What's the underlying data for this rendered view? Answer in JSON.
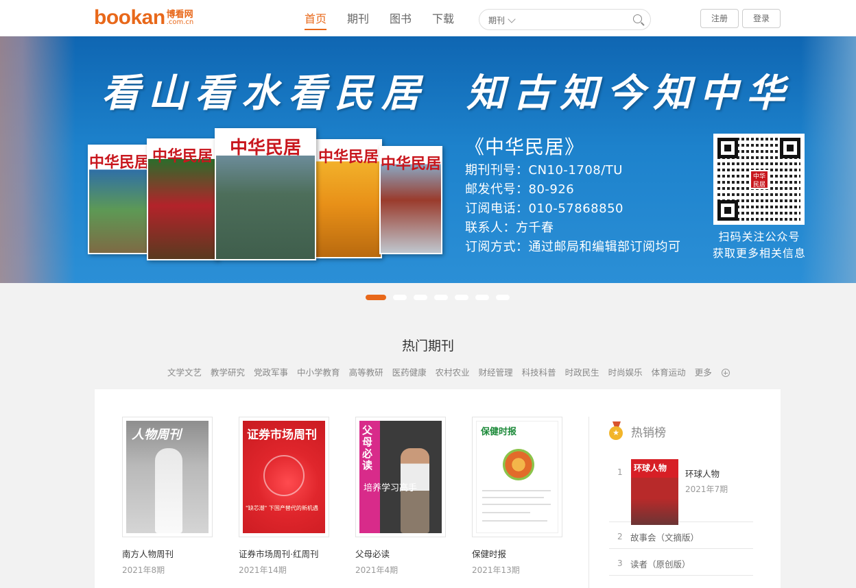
{
  "header": {
    "logo_main": "bookan",
    "logo_cn": "博看网",
    "logo_domain": ".com.cn",
    "nav": [
      "首页",
      "期刊",
      "图书",
      "下载"
    ],
    "search_type": "期刊",
    "search_placeholder": "",
    "register_label": "注册",
    "login_label": "登录"
  },
  "banner": {
    "slogan_left": "看山看水看民居",
    "slogan_right": "知古知今知中华",
    "cover_title": "中华民居",
    "info_title": "《中华民居》",
    "info_lines": [
      "期刊刊号：CN10-1708/TU",
      "邮发代号：80-926",
      "订阅电话：010-57868850",
      "联系人：方千春",
      "订阅方式：通过邮局和编辑部订阅均可"
    ],
    "qr_logo_text": "中华民居",
    "qr_caption": [
      "扫码关注公众号",
      "获取更多相关信息"
    ],
    "slide_count": 7,
    "active_slide": 1
  },
  "section": {
    "title": "热门期刊",
    "categories": [
      "文学文艺",
      "教学研究",
      "党政军事",
      "中小学教育",
      "高等教研",
      "医药健康",
      "农村农业",
      "财经管理",
      "科技科普",
      "时政民生",
      "时尚娱乐",
      "体育运动"
    ],
    "more_label": "更多"
  },
  "magazines": [
    {
      "name": "南方人物周刊",
      "issue": "2021年8期",
      "cover_text": "人物周刊"
    },
    {
      "name": "证券市场周刊·红周刊",
      "issue": "2021年14期",
      "cover_text": "证券市场周刊",
      "cover_caption": "\"缺芯潮\" 下国产替代的新机遇"
    },
    {
      "name": "父母必读",
      "issue": "2021年4期",
      "cover_text": "父母必读",
      "cover_caption": "培养学习高手"
    },
    {
      "name": "保健时报",
      "issue": "2021年13期",
      "cover_text": "保健时报"
    }
  ],
  "ranking": {
    "title": "热销榜",
    "items": [
      {
        "rank": "1",
        "name": "环球人物",
        "issue": "2021年7期",
        "cover_text": "环球人物"
      },
      {
        "rank": "2",
        "name": "故事会（文摘版）"
      },
      {
        "rank": "3",
        "name": "读者（原创版）"
      }
    ]
  },
  "colors": {
    "accent": "#e8681a",
    "banner_blue": "#1d82cc",
    "brand_red": "#c8161d"
  }
}
